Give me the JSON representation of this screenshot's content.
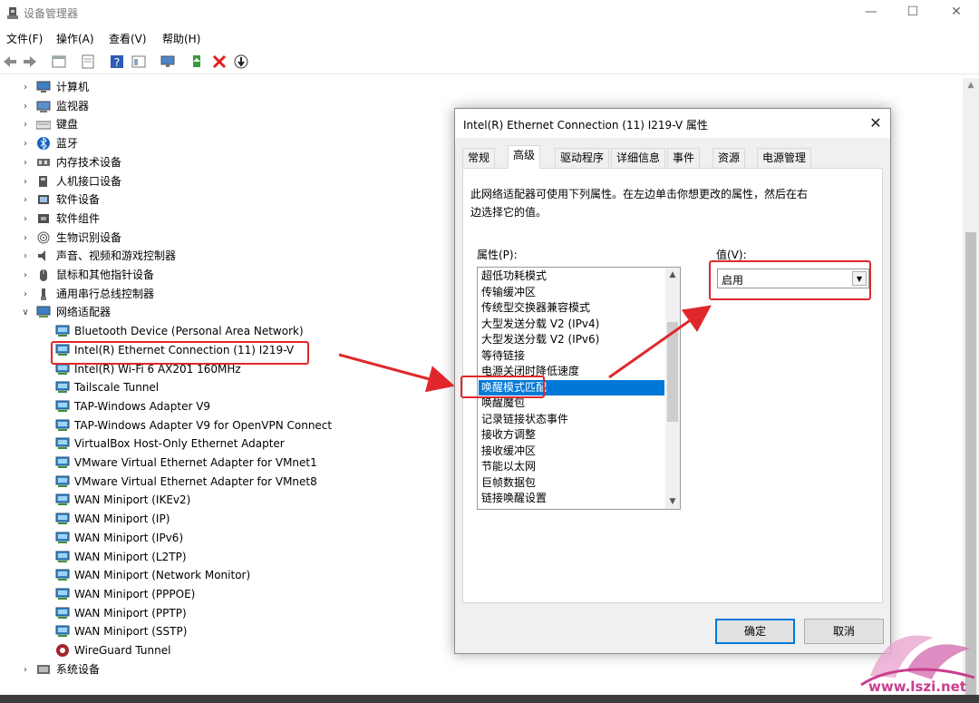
{
  "window": {
    "title": "设备管理器",
    "min_glyph": "—",
    "max_glyph": "☐",
    "close_glyph": "✕"
  },
  "menu": [
    "文件(F)",
    "操作(A)",
    "查看(V)",
    "帮助(H)"
  ],
  "tree": {
    "categories": [
      {
        "label": "计算机",
        "icon": "computer-icon",
        "expanded": false
      },
      {
        "label": "监视器",
        "icon": "monitor-icon",
        "expanded": false
      },
      {
        "label": "键盘",
        "icon": "keyboard-icon",
        "expanded": false
      },
      {
        "label": "蓝牙",
        "icon": "bluetooth-icon",
        "expanded": false
      },
      {
        "label": "内存技术设备",
        "icon": "memory-icon",
        "expanded": false
      },
      {
        "label": "人机接口设备",
        "icon": "hid-icon",
        "expanded": false
      },
      {
        "label": "软件设备",
        "icon": "software-device-icon",
        "expanded": false
      },
      {
        "label": "软件组件",
        "icon": "software-component-icon",
        "expanded": false
      },
      {
        "label": "生物识别设备",
        "icon": "fingerprint-icon",
        "expanded": false
      },
      {
        "label": "声音、视频和游戏控制器",
        "icon": "speaker-icon",
        "expanded": false
      },
      {
        "label": "鼠标和其他指针设备",
        "icon": "mouse-icon",
        "expanded": false
      },
      {
        "label": "通用串行总线控制器",
        "icon": "usb-icon",
        "expanded": false
      },
      {
        "label": "网络适配器",
        "icon": "network-adapter-icon",
        "expanded": true
      }
    ],
    "adapters": [
      "Bluetooth Device (Personal Area Network)",
      "Intel(R) Ethernet Connection (11) I219-V",
      "Intel(R) Wi-Fi 6 AX201 160MHz",
      "Tailscale Tunnel",
      "TAP-Windows Adapter V9",
      "TAP-Windows Adapter V9 for OpenVPN Connect",
      "VirtualBox Host-Only Ethernet Adapter",
      "VMware Virtual Ethernet Adapter for VMnet1",
      "VMware Virtual Ethernet Adapter for VMnet8",
      "WAN Miniport (IKEv2)",
      "WAN Miniport (IP)",
      "WAN Miniport (IPv6)",
      "WAN Miniport (L2TP)",
      "WAN Miniport (Network Monitor)",
      "WAN Miniport (PPPOE)",
      "WAN Miniport (PPTP)",
      "WAN Miniport (SSTP)",
      "WireGuard Tunnel"
    ],
    "after": [
      {
        "label": "系统设备",
        "icon": "system-device-icon"
      }
    ],
    "highlighted_adapter_index": 1
  },
  "dialog": {
    "title": "Intel(R) Ethernet Connection (11) I219-V 属性",
    "close_glyph": "✕",
    "tabs": [
      "常规",
      "高级",
      "驱动程序",
      "详细信息",
      "事件",
      "资源",
      "电源管理"
    ],
    "active_tab": "高级",
    "description_line1": "此网络适配器可使用下列属性。在左边单击你想更改的属性，然后在右",
    "description_line2": "边选择它的值。",
    "property_label": "属性(P):",
    "value_label": "值(V):",
    "properties": [
      "超低功耗模式",
      "传输缓冲区",
      "传统型交换器兼容模式",
      "大型发送分载 V2 (IPv4)",
      "大型发送分载 V2 (IPv6)",
      "等待链接",
      "电源关闭时降低速度",
      "唤醒模式匹配",
      "唤醒魔包",
      "记录链接状态事件",
      "接收方调整",
      "接收缓冲区",
      "节能以太网",
      "巨帧数据包",
      "链接唤醒设置"
    ],
    "selected_property": "唤醒模式匹配",
    "value": "启用",
    "ok_label": "确定",
    "cancel_label": "取消"
  },
  "watermark": {
    "text": "www.lszi.net"
  },
  "colors": {
    "selection": "#0078d7",
    "highlight_box": "#e0282c",
    "arrow": "#e0282c"
  }
}
